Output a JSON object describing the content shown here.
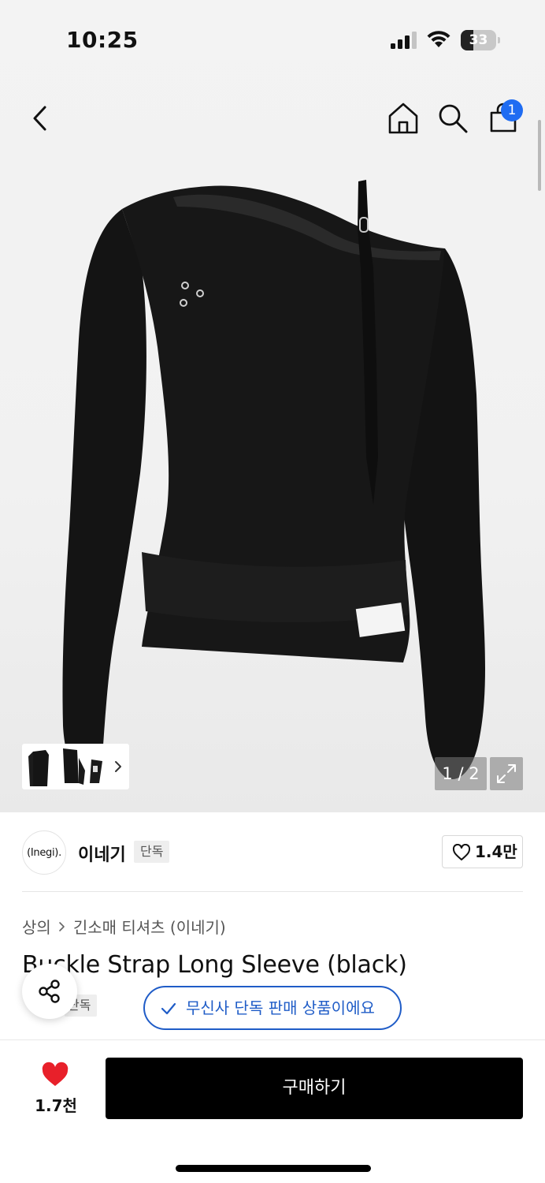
{
  "status_bar": {
    "time": "10:25",
    "battery": "33"
  },
  "nav": {
    "cart_count": "1",
    "icons": [
      "back-icon",
      "home-icon",
      "search-icon",
      "shopping-bag-icon"
    ]
  },
  "gallery": {
    "counter": "1 / 2"
  },
  "brand": {
    "logo_text": "(Inegi).",
    "name": "이네기",
    "tag": "단독",
    "likes": "1.4만"
  },
  "breadcrumb": {
    "category": "상의",
    "subcategory": "긴소매 티셔츠 (이네기)"
  },
  "product": {
    "title": "Buckle Strap Long Sleeve (black)",
    "tag": "단독"
  },
  "exclusive_banner": {
    "text": "무신사 단독 판매 상품이에요"
  },
  "bottom_bar": {
    "wish_count": "1.7천",
    "buy_label": "구매하기"
  },
  "colors": {
    "accent": "#1f6cf2",
    "banner": "#1f5cc7",
    "heart": "#e8202a",
    "buy": "#000000"
  }
}
